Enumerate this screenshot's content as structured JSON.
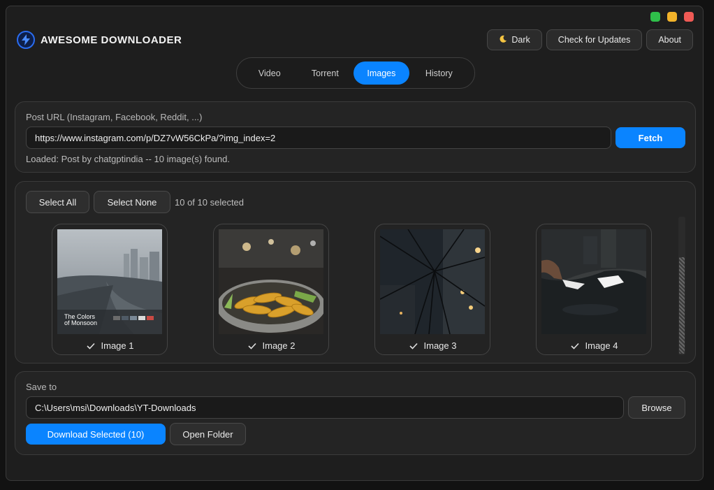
{
  "app": {
    "title": "AWESOME DOWNLOADER",
    "accent": "#0a84ff"
  },
  "window_controls": [
    "green",
    "yellow",
    "red"
  ],
  "header": {
    "theme_label": "Dark",
    "theme_icon": "moon-icon",
    "updates_label": "Check for Updates",
    "about_label": "About"
  },
  "tabs": [
    {
      "label": "Video",
      "active": false
    },
    {
      "label": "Torrent",
      "active": false
    },
    {
      "label": "Images",
      "active": true
    },
    {
      "label": "History",
      "active": false
    }
  ],
  "url_panel": {
    "label": "Post URL (Instagram, Facebook, Reddit, ...)",
    "url_value": "https://www.instagram.com/p/DZ7vW56CkPa/?img_index=2",
    "fetch_label": "Fetch",
    "status": "Loaded: Post by chatgptindia -- 10 image(s) found."
  },
  "gallery": {
    "select_all_label": "Select All",
    "select_none_label": "Select None",
    "selection_count": "10 of 10 selected",
    "images": [
      {
        "label": "Image 1",
        "checked": true,
        "overlay_text": "The Colors of Monsoon"
      },
      {
        "label": "Image 2",
        "checked": true
      },
      {
        "label": "Image 3",
        "checked": true
      },
      {
        "label": "Image 4",
        "checked": true
      }
    ]
  },
  "save_panel": {
    "label": "Save to",
    "path_value": "C:\\Users\\msi\\Downloads\\YT-Downloads",
    "browse_label": "Browse",
    "download_label": "Download Selected (10)",
    "open_folder_label": "Open Folder"
  }
}
